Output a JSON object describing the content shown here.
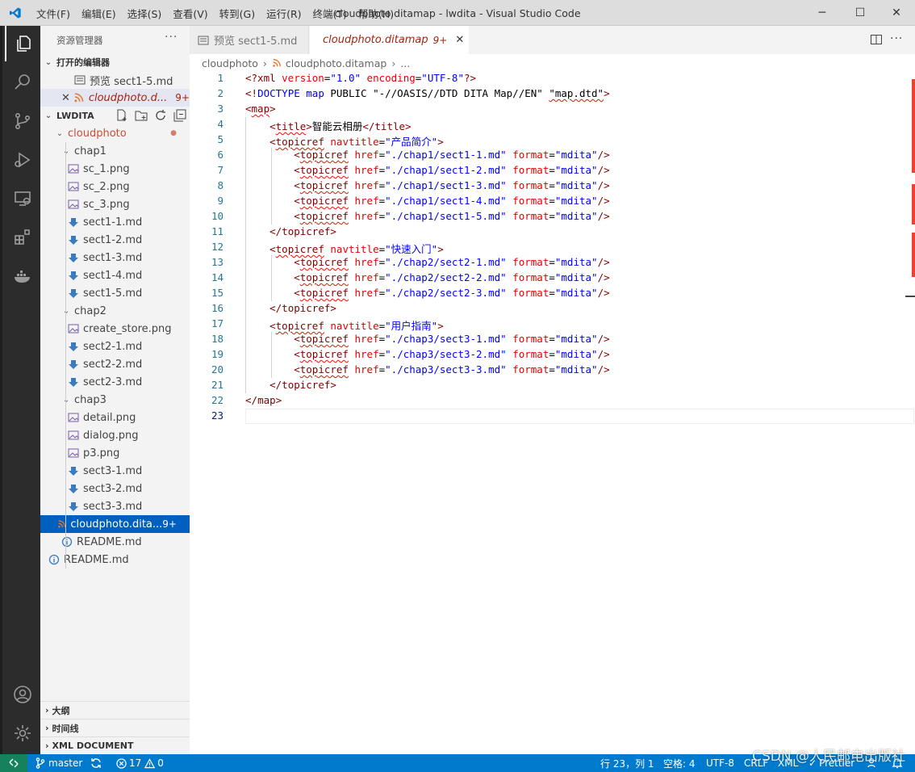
{
  "titlebar": {
    "menu": [
      "文件(F)",
      "编辑(E)",
      "选择(S)",
      "查看(V)",
      "转到(G)",
      "运行(R)",
      "终端(T)",
      "帮助(H)"
    ],
    "window_title": "cloudphoto.ditamap - lwdita - Visual Studio Code",
    "minimize": "─",
    "maximize": "☐",
    "close": "✕"
  },
  "sidebar": {
    "header": "资源管理器",
    "more": "···",
    "open_editors": {
      "label": "打开的编辑器",
      "items": [
        {
          "label": "预览 sect1-5.md",
          "badge": ""
        },
        {
          "label": "cloudphoto.d...",
          "badge": "9+"
        }
      ]
    },
    "workspace": {
      "label": "LWDITA",
      "items": [
        {
          "label": "cloudphoto",
          "badge": "●"
        },
        {
          "label": "chap1"
        },
        {
          "label": "sc_1.png"
        },
        {
          "label": "sc_2.png"
        },
        {
          "label": "sc_3.png"
        },
        {
          "label": "sect1-1.md"
        },
        {
          "label": "sect1-2.md"
        },
        {
          "label": "sect1-3.md"
        },
        {
          "label": "sect1-4.md"
        },
        {
          "label": "sect1-5.md"
        },
        {
          "label": "chap2"
        },
        {
          "label": "create_store.png"
        },
        {
          "label": "sect2-1.md"
        },
        {
          "label": "sect2-2.md"
        },
        {
          "label": "sect2-3.md"
        },
        {
          "label": "chap3"
        },
        {
          "label": "detail.png"
        },
        {
          "label": "dialog.png"
        },
        {
          "label": "p3.png"
        },
        {
          "label": "sect3-1.md"
        },
        {
          "label": "sect3-2.md"
        },
        {
          "label": "sect3-3.md"
        },
        {
          "label": "cloudphoto.dita...",
          "badge": "9+"
        },
        {
          "label": "README.md"
        },
        {
          "label": "README.md"
        }
      ]
    },
    "bottom_sections": [
      "大纲",
      "时间线",
      "XML DOCUMENT"
    ]
  },
  "tabs": [
    {
      "label": "预览 sect1-5.md"
    },
    {
      "label": "cloudphoto.ditamap",
      "badge": "9+",
      "close": "✕"
    }
  ],
  "breadcrumb": [
    "cloudphoto",
    "›",
    "cloudphoto.ditamap",
    "›",
    "..."
  ],
  "editor": {
    "line_numbers": [
      "1",
      "2",
      "3",
      "4",
      "5",
      "6",
      "7",
      "8",
      "9",
      "10",
      "11",
      "12",
      "13",
      "14",
      "15",
      "16",
      "17",
      "18",
      "19",
      "20",
      "21",
      "22",
      "23"
    ]
  },
  "code": {
    "l1": [
      "<?xml ",
      "version",
      "=",
      "\"1.0\"",
      " ",
      "encoding",
      "=",
      "\"UTF-8\"",
      "?>"
    ],
    "l2": [
      "<!",
      "DOCTYPE",
      " ",
      "map",
      " PUBLIC ",
      "\"-//OASIS//DTD DITA Map//EN\"",
      " ",
      "\"map.dtd\"",
      ">"
    ],
    "l3": [
      "<",
      "map",
      ">"
    ],
    "title_text": "智能云相册",
    "nav1": "\"产品简介\"",
    "nav2": "\"快速入门\"",
    "nav3": "\"用户指南\"",
    "hrefs": [
      "\"./chap1/sect1-1.md\"",
      "\"./chap1/sect1-2.md\"",
      "\"./chap1/sect1-3.md\"",
      "\"./chap1/sect1-4.md\"",
      "\"./chap1/sect1-5.md\"",
      "\"./chap2/sect2-1.md\"",
      "\"./chap2/sect2-2.md\"",
      "\"./chap2/sect2-3.md\"",
      "\"./chap3/sect3-1.md\"",
      "\"./chap3/sect3-2.md\"",
      "\"./chap3/sect3-3.md\""
    ],
    "format_val": "\"mdita\"",
    "topicref": "topicref",
    "href_attr": "href",
    "format_attr": "format",
    "navtitle_attr": "navtitle",
    "title_tag": "title",
    "map_tag": "map"
  },
  "statusbar": {
    "branch": "master",
    "errors": "17",
    "warnings": "0",
    "position": "行 23，列 1",
    "spaces": "空格: 4",
    "encoding": "UTF-8",
    "eol": "CRLF",
    "language": "XML",
    "prettier": "Prettier",
    "watermark": "CSDN @人民邮电出版社"
  },
  "colors": {
    "accent": "#007acc",
    "selection": "#0060c0",
    "error": "#e51400",
    "modified": "#a1260d"
  }
}
